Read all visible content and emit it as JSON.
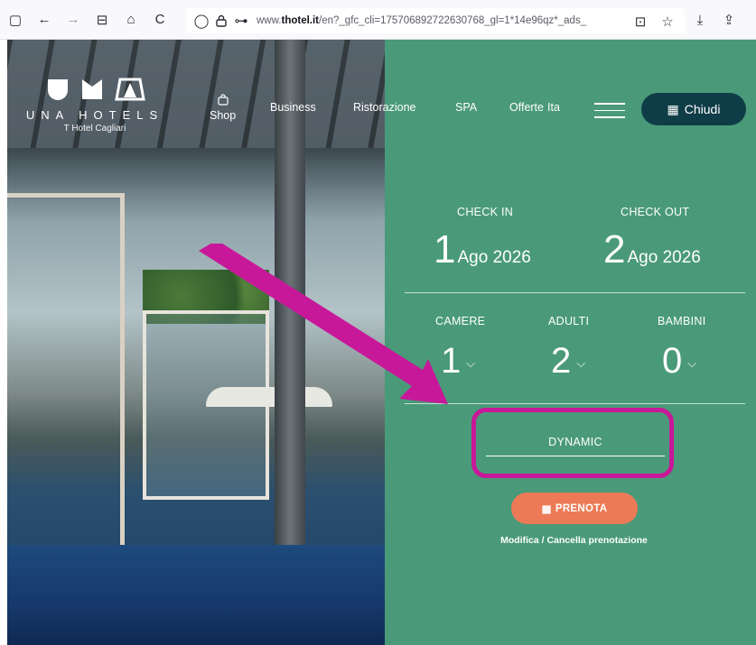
{
  "browser": {
    "url_prefix": "www.",
    "url_domain": "thotel.it",
    "url_rest": "/en?_gfc_cli=175706892722630768_gl=1*14e96qz*_ads_",
    "icons": {
      "sidebar": "▢",
      "back": "←",
      "forward": "→",
      "reader": "⊟",
      "home": "⌂",
      "reload": "C",
      "shield": "◯",
      "lock": "🔒",
      "permissions": "⊶",
      "save_page": "⊡",
      "bookmark": "☆",
      "downloads": "⤓",
      "share": "⇪"
    }
  },
  "header": {
    "logo_name": "UNA HOTELS",
    "logo_sub": "T Hotel Cagliari",
    "nav": {
      "shop": "Shop",
      "business": "Business",
      "ristorazione": "Ristorazione",
      "spa": "SPA",
      "offerte": "Offerte",
      "ita": "Ita"
    },
    "close_label": "Chiudi",
    "close_icon": "▦"
  },
  "booking": {
    "check_in_label": "CHECK IN",
    "check_in_day": "1",
    "check_in_month": "Ago 2026",
    "check_out_label": "CHECK OUT",
    "check_out_day": "2",
    "check_out_month": "Ago 2026",
    "rooms_label": "CAMERE",
    "rooms_value": "1",
    "adults_label": "ADULTI",
    "adults_value": "2",
    "children_label": "BAMBINI",
    "children_value": "0",
    "chevron": "⌵",
    "rate_field": "DYNAMIC",
    "book_label": "PRENOTA",
    "book_icon": "▦",
    "manage_link": "Modifica / Cancella prenotazione"
  },
  "colors": {
    "panel": "#4a9a79",
    "close_button": "#0f3d47",
    "book_button": "#ec7a56",
    "annotation": "#c8189a"
  }
}
